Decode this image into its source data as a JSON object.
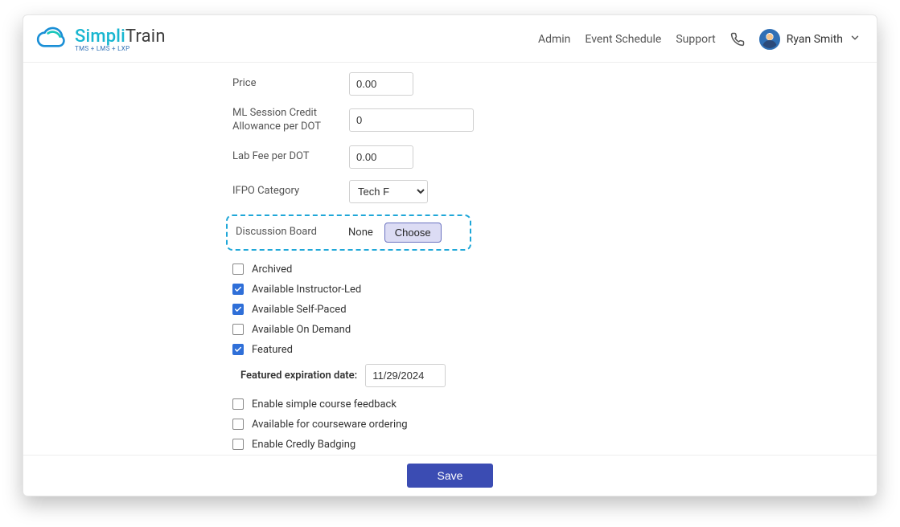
{
  "logo": {
    "prefix": "Simpli",
    "suffix": "Train",
    "subtitle": "TMS + LMS + LXP"
  },
  "nav": {
    "admin": "Admin",
    "schedule": "Event Schedule",
    "support": "Support"
  },
  "user": {
    "name": "Ryan Smith"
  },
  "form": {
    "price": {
      "label": "Price",
      "value": "0.00"
    },
    "ml": {
      "label": "ML Session Credit Allowance per DOT",
      "value": "0"
    },
    "lab": {
      "label": "Lab Fee per DOT",
      "value": "0.00"
    },
    "ifpo": {
      "label": "IFPO Category",
      "value": "Tech F"
    },
    "disc": {
      "label": "Discussion Board",
      "none": "None",
      "choose": "Choose"
    }
  },
  "checks": {
    "archived": {
      "label": "Archived",
      "on": false
    },
    "ilt": {
      "label": "Available Instructor-Led",
      "on": true
    },
    "self": {
      "label": "Available Self-Paced",
      "on": true
    },
    "ondemand": {
      "label": "Available On Demand",
      "on": false
    },
    "featured": {
      "label": "Featured",
      "on": true
    },
    "feedback": {
      "label": "Enable simple course feedback",
      "on": false
    },
    "courseware": {
      "label": "Available for courseware ordering",
      "on": false
    },
    "credly": {
      "label": "Enable Credly Badging",
      "on": false
    }
  },
  "featured_exp": {
    "label": "Featured expiration date:",
    "value": "11/29/2024"
  },
  "buttons": {
    "save": "Save"
  }
}
